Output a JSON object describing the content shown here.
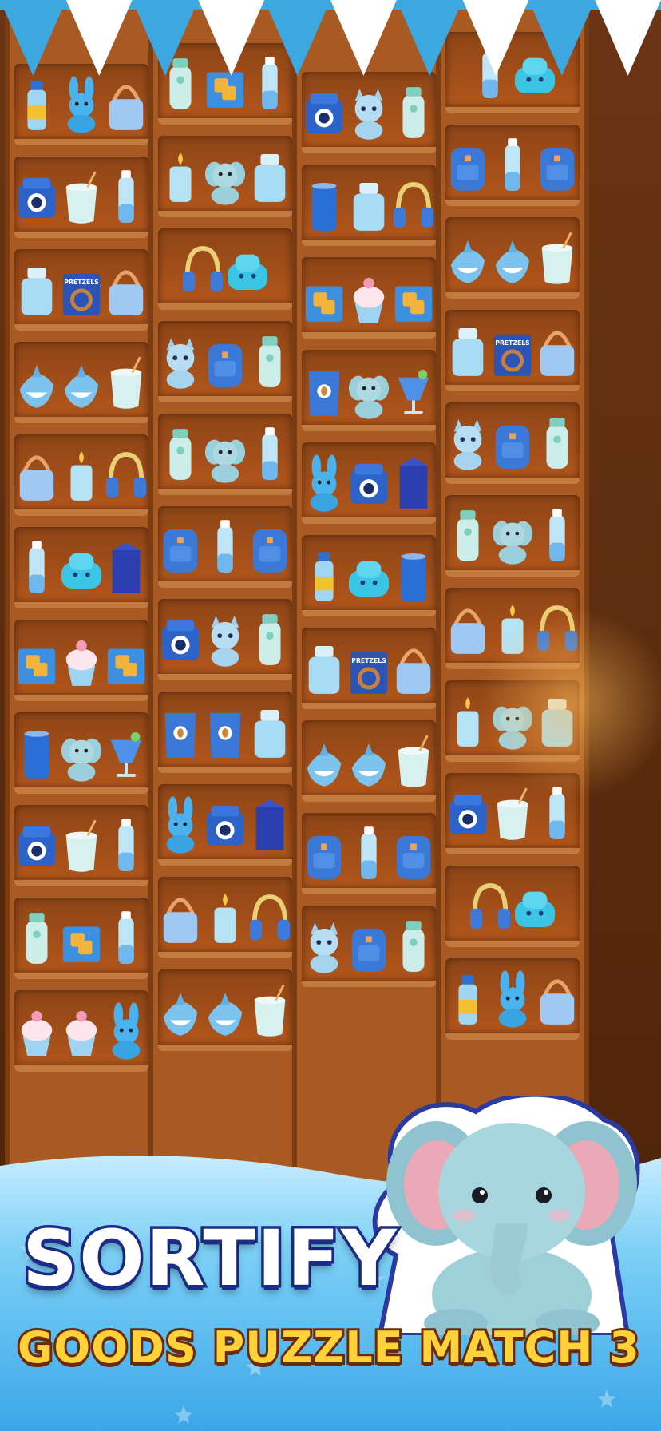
{
  "game": {
    "title": "SORTIFY",
    "subtitle": "GOODS PUZZLE MATCH 3"
  },
  "theme": {
    "shelf_wood": "#a95a22",
    "shelf_back": "#8e4516",
    "sky_blue": "#4fb8ea",
    "title_fill": "#ffffff",
    "title_outline": "#1d2c8a",
    "subtitle_fill": "#ffd23a",
    "subtitle_outline": "#6b2b08"
  },
  "shelves": [
    [
      [
        "bottle",
        "bunny",
        "handbag"
      ],
      [
        "camera",
        "milk",
        "water-bottle"
      ],
      [
        "jar",
        "pretzels",
        "handbag"
      ],
      [
        "shark",
        "shark",
        "milk"
      ],
      [
        "handbag",
        "candle",
        "headphones"
      ],
      [
        "water-bottle",
        "car",
        "carton"
      ],
      [
        "crackers",
        "ice-cream",
        "crackers"
      ],
      [
        "can",
        "elephant",
        "drink-glass"
      ],
      [
        "camera",
        "milk",
        "water-bottle"
      ],
      [
        "thermos",
        "crackers",
        "water-bottle"
      ],
      [
        "ice-cream",
        "ice-cream",
        "bunny"
      ]
    ],
    [
      [
        "thermos",
        "crackers",
        "water-bottle"
      ],
      [
        "candle",
        "elephant",
        "jar"
      ],
      [
        "headphones",
        "car"
      ],
      [
        "cat",
        "backpack",
        "thermos"
      ],
      [
        "thermos",
        "elephant",
        "water-bottle"
      ],
      [
        "backpack",
        "water-bottle",
        "backpack"
      ],
      [
        "camera",
        "cat",
        "thermos"
      ],
      [
        "coffee-bag",
        "coffee-bag",
        "jar"
      ],
      [
        "bunny",
        "camera",
        "carton"
      ],
      [
        "handbag",
        "candle",
        "headphones"
      ],
      [
        "shark",
        "shark",
        "milk"
      ]
    ],
    [
      [
        "camera",
        "cat",
        "thermos"
      ],
      [
        "can",
        "jar",
        "headphones"
      ],
      [
        "crackers",
        "ice-cream",
        "crackers"
      ],
      [
        "coffee-bag",
        "elephant",
        "drink-glass"
      ],
      [
        "bunny",
        "camera",
        "carton"
      ],
      [
        "bottle",
        "car",
        "can"
      ],
      [
        "jar",
        "pretzels",
        "handbag"
      ],
      [
        "shark",
        "shark",
        "milk"
      ],
      [
        "backpack",
        "water-bottle",
        "backpack"
      ],
      [
        "cat",
        "backpack",
        "thermos"
      ]
    ],
    [
      [
        "water-bottle",
        "car"
      ],
      [
        "backpack",
        "water-bottle",
        "backpack"
      ],
      [
        "shark",
        "shark",
        "milk"
      ],
      [
        "jar",
        "pretzels",
        "handbag"
      ],
      [
        "cat",
        "backpack",
        "thermos"
      ],
      [
        "thermos",
        "elephant",
        "water-bottle"
      ],
      [
        "handbag",
        "candle",
        "headphones"
      ],
      [
        "candle",
        "elephant",
        "jar"
      ],
      [
        "camera",
        "milk",
        "water-bottle"
      ],
      [
        "headphones",
        "car"
      ],
      [
        "bottle",
        "bunny",
        "handbag"
      ]
    ]
  ],
  "pretzel_label": "PRETZELS",
  "mascot_icon": "elephant-plush-icon"
}
